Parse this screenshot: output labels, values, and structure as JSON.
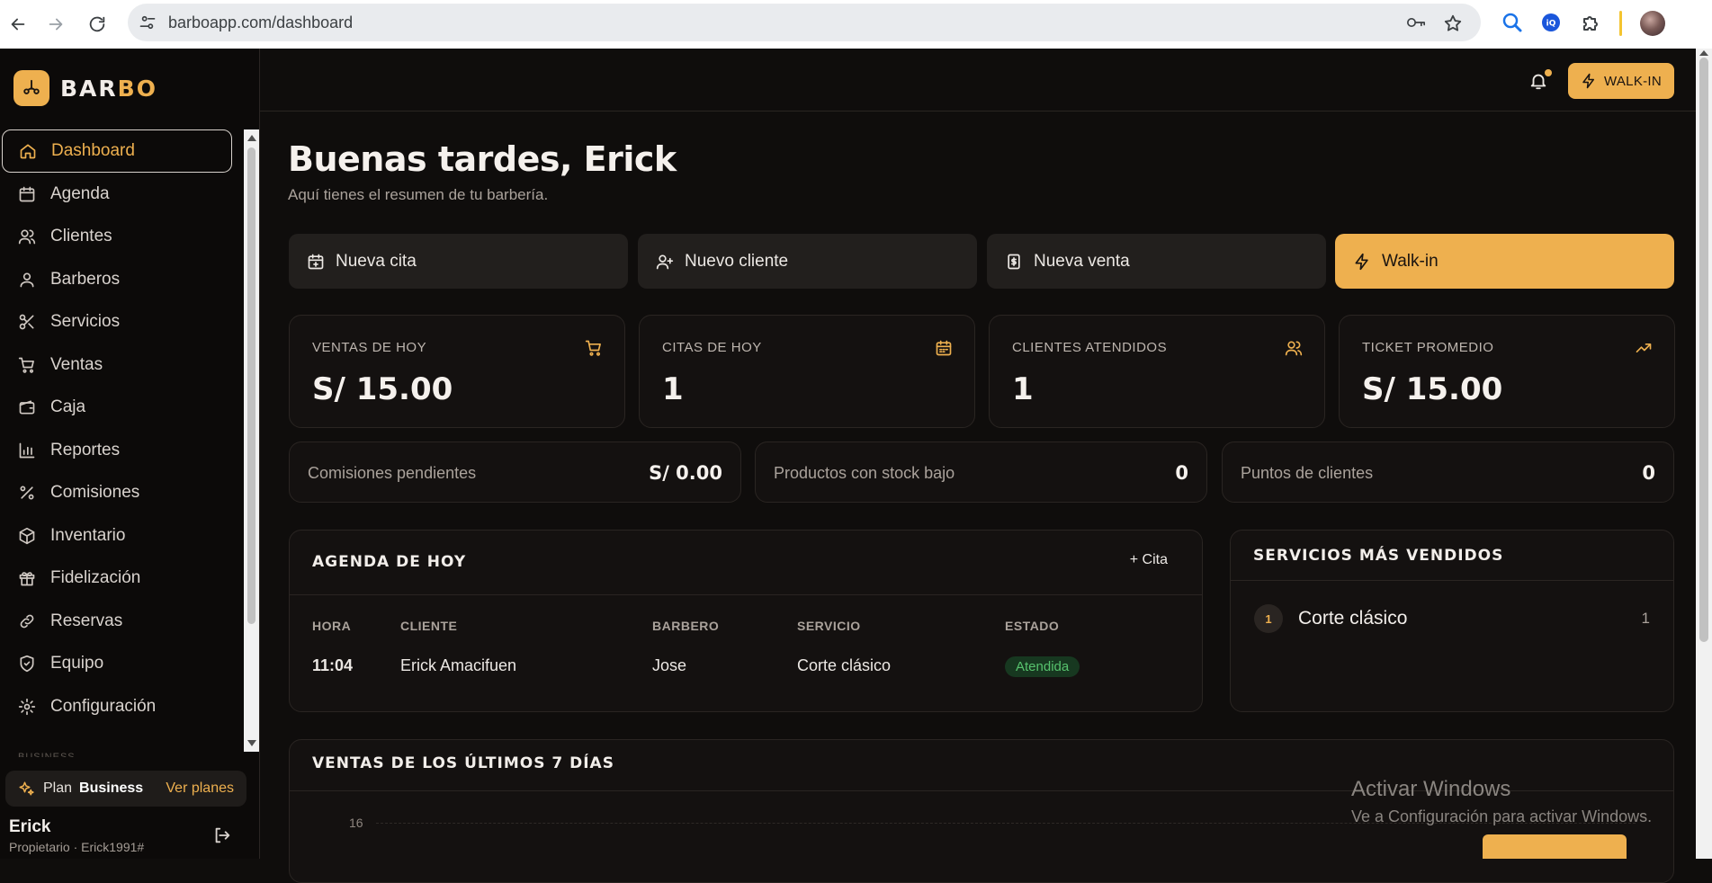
{
  "browser": {
    "url": "barboapp.com/dashboard"
  },
  "brand": {
    "part1": "BAR",
    "part2": "BO",
    "accent": "#eeb04f"
  },
  "sidebar": {
    "items": [
      {
        "label": "Dashboard",
        "icon": "home-icon",
        "active": true
      },
      {
        "label": "Agenda",
        "icon": "calendar-icon"
      },
      {
        "label": "Clientes",
        "icon": "users-icon"
      },
      {
        "label": "Barberos",
        "icon": "user-icon"
      },
      {
        "label": "Servicios",
        "icon": "scissors-icon"
      },
      {
        "label": "Ventas",
        "icon": "cart-icon"
      },
      {
        "label": "Caja",
        "icon": "wallet-icon"
      },
      {
        "label": "Reportes",
        "icon": "bar-chart-icon"
      },
      {
        "label": "Comisiones",
        "icon": "percent-icon"
      },
      {
        "label": "Inventario",
        "icon": "package-icon"
      },
      {
        "label": "Fidelización",
        "icon": "gift-icon"
      },
      {
        "label": "Reservas",
        "icon": "link-icon"
      },
      {
        "label": "Equipo",
        "icon": "shield-icon"
      },
      {
        "label": "Configuración",
        "icon": "gear-icon"
      }
    ],
    "section_peek": "BUSINESS",
    "plan": {
      "label": "Plan",
      "name": "Business",
      "link": "Ver planes"
    },
    "user": {
      "name": "Erick",
      "role": "Propietario · Erick1991#"
    }
  },
  "topbar": {
    "walkin_label": "WALK-IN"
  },
  "main": {
    "greeting": "Buenas tardes, Erick",
    "subtitle": "Aquí tienes el resumen de tu barbería.",
    "quick_actions": [
      {
        "label": "Nueva cita",
        "icon": "calendar-plus-icon"
      },
      {
        "label": "Nuevo cliente",
        "icon": "user-plus-icon"
      },
      {
        "label": "Nueva venta",
        "icon": "receipt-icon"
      },
      {
        "label": "Walk-in",
        "icon": "bolt-icon"
      }
    ],
    "stats": [
      {
        "label": "VENTAS DE HOY",
        "value": "S/ 15.00",
        "icon": "cart-icon"
      },
      {
        "label": "CITAS DE HOY",
        "value": "1",
        "icon": "calendar-icon"
      },
      {
        "label": "CLIENTES ATENDIDOS",
        "value": "1",
        "icon": "users-icon"
      },
      {
        "label": "TICKET PROMEDIO",
        "value": "S/ 15.00",
        "icon": "trending-up-icon"
      }
    ],
    "mini_stats": [
      {
        "label": "Comisiones pendientes",
        "value": "S/ 0.00"
      },
      {
        "label": "Productos con stock bajo",
        "value": "0"
      },
      {
        "label": "Puntos de clientes",
        "value": "0"
      }
    ],
    "agenda": {
      "title": "AGENDA DE HOY",
      "add_label": "+ Cita",
      "columns": [
        "HORA",
        "CLIENTE",
        "BARBERO",
        "SERVICIO",
        "ESTADO"
      ],
      "rows": [
        {
          "hora": "11:04",
          "cliente": "Erick Amacifuen",
          "barbero": "Jose",
          "servicio": "Corte clásico",
          "estado": "Atendida"
        }
      ]
    },
    "top_services": {
      "title": "SERVICIOS MÁS VENDIDOS",
      "items": [
        {
          "rank": "1",
          "name": "Corte clásico",
          "count": "1"
        }
      ]
    },
    "sales_chart": {
      "title": "VENTAS DE LOS ÚLTIMOS 7 DÍAS",
      "y_tick": "16"
    }
  },
  "watermark": {
    "line1": "Activar Windows",
    "line2": "Ve a Configuración para activar Windows."
  }
}
